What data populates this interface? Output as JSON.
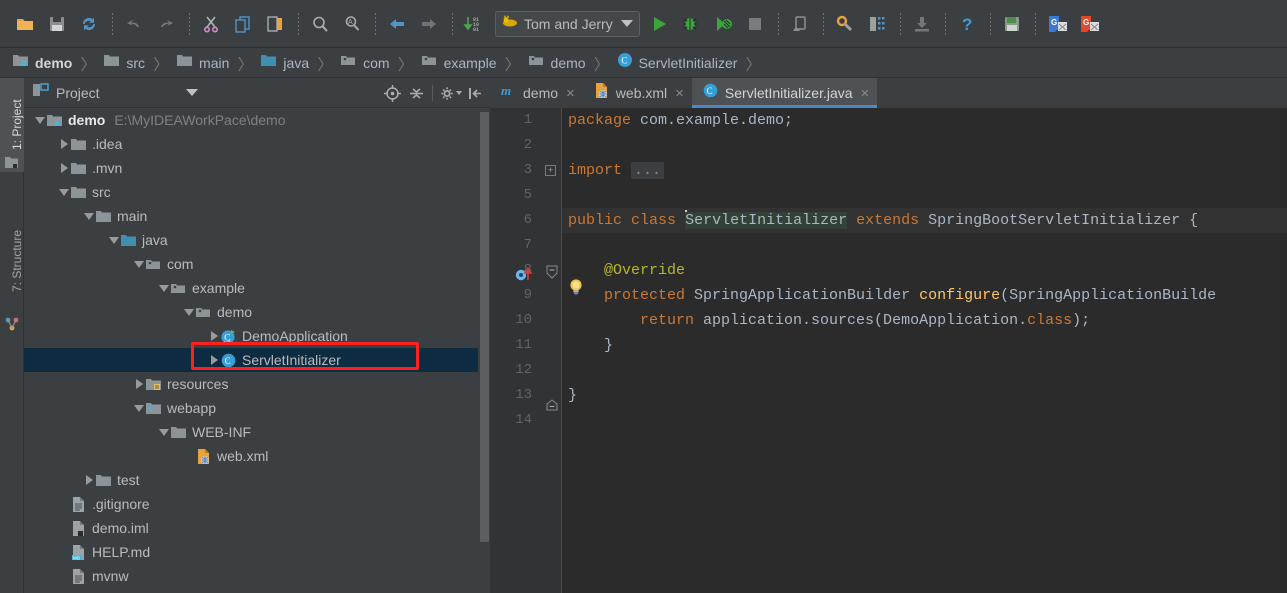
{
  "toolbar": {
    "icons": [
      {
        "name": "open-folder-icon",
        "label": "Open"
      },
      {
        "name": "save-all-icon",
        "label": "Save All"
      },
      {
        "name": "sync-refresh-icon",
        "label": "Synchronize"
      },
      {
        "name": "undo-icon",
        "label": "Undo"
      },
      {
        "name": "redo-icon",
        "label": "Redo"
      },
      {
        "name": "cut-icon",
        "label": "Cut"
      },
      {
        "name": "copy-icon",
        "label": "Copy"
      },
      {
        "name": "paste-icon",
        "label": "Paste"
      },
      {
        "name": "find-icon",
        "label": "Find"
      },
      {
        "name": "replace-icon",
        "label": "Replace"
      },
      {
        "name": "back-icon",
        "label": "Back"
      },
      {
        "name": "forward-icon",
        "label": "Forward"
      },
      {
        "name": "compile-icon",
        "label": "Compile"
      }
    ],
    "run_config": {
      "name": "Tom and Jerry",
      "icon": "tomcat-icon"
    },
    "run_icons": [
      {
        "name": "run-icon",
        "label": "Run"
      },
      {
        "name": "debug-icon",
        "label": "Debug"
      },
      {
        "name": "run-coverage-icon",
        "label": "Run with Coverage"
      },
      {
        "name": "stop-icon",
        "label": "Stop"
      }
    ],
    "right_icons": [
      {
        "name": "update-app-icon",
        "label": "Update application"
      },
      {
        "name": "settings-wrench-icon",
        "label": "Settings"
      },
      {
        "name": "project-structure-icon",
        "label": "Project Structure"
      },
      {
        "name": "download-icon",
        "label": "Update Project"
      },
      {
        "name": "help-icon",
        "label": "Help"
      },
      {
        "name": "save-floppy-icon",
        "label": "Save"
      },
      {
        "name": "translate-blue-icon",
        "label": "Translate"
      },
      {
        "name": "translate-red-icon",
        "label": "Translate Replace"
      }
    ]
  },
  "breadcrumb": {
    "items": [
      {
        "label": "demo",
        "icon": "module-folder-icon"
      },
      {
        "label": "src",
        "icon": "folder-icon"
      },
      {
        "label": "main",
        "icon": "folder-icon"
      },
      {
        "label": "java",
        "icon": "source-folder-icon"
      },
      {
        "label": "com",
        "icon": "package-icon"
      },
      {
        "label": "example",
        "icon": "package-icon"
      },
      {
        "label": "demo",
        "icon": "package-icon"
      },
      {
        "label": "ServletInitializer",
        "icon": "class-icon"
      }
    ],
    "separator": "〉"
  },
  "tool_window_tabs": [
    {
      "label": "1: Project",
      "icon": "project-icon",
      "active": true
    },
    {
      "label": "7: Structure",
      "icon": "structure-icon",
      "active": false
    }
  ],
  "project_panel": {
    "title": "Project",
    "title_icon": "project-view-icon",
    "dropdown_icon": "chevron-down-icon",
    "tools": [
      {
        "name": "locate-target-icon",
        "label": "Select Opened File"
      },
      {
        "name": "collapse-all-icon",
        "label": "Collapse All"
      },
      {
        "name": "gear-settings-icon",
        "label": "Settings"
      },
      {
        "name": "hide-panel-icon",
        "label": "Hide"
      }
    ],
    "tree": [
      {
        "depth": 0,
        "arrow": "expanded",
        "icon": "module-icon",
        "label": "demo",
        "bold": true,
        "path": "E:\\MyIDEAWorkPace\\demo",
        "selected": false
      },
      {
        "depth": 1,
        "arrow": "collapsed",
        "icon": "folder-icon",
        "label": ".idea",
        "bold": false,
        "path": "",
        "selected": false
      },
      {
        "depth": 1,
        "arrow": "collapsed",
        "icon": "folder-icon",
        "label": ".mvn",
        "bold": false,
        "path": "",
        "selected": false
      },
      {
        "depth": 1,
        "arrow": "expanded",
        "icon": "folder-icon",
        "label": "src",
        "bold": false,
        "path": "",
        "selected": false
      },
      {
        "depth": 2,
        "arrow": "expanded",
        "icon": "folder-icon",
        "label": "main",
        "bold": false,
        "path": "",
        "selected": false
      },
      {
        "depth": 3,
        "arrow": "expanded",
        "icon": "source-folder-icon",
        "label": "java",
        "bold": false,
        "path": "",
        "selected": false
      },
      {
        "depth": 4,
        "arrow": "expanded",
        "icon": "package-icon",
        "label": "com",
        "bold": false,
        "path": "",
        "selected": false
      },
      {
        "depth": 5,
        "arrow": "expanded",
        "icon": "package-icon",
        "label": "example",
        "bold": false,
        "path": "",
        "selected": false
      },
      {
        "depth": 6,
        "arrow": "expanded",
        "icon": "package-icon",
        "label": "demo",
        "bold": false,
        "path": "",
        "selected": false
      },
      {
        "depth": 7,
        "arrow": "collapsed",
        "icon": "spring-class-icon",
        "label": "DemoApplication",
        "bold": false,
        "path": "",
        "selected": false
      },
      {
        "depth": 7,
        "arrow": "collapsed",
        "icon": "class-icon",
        "label": "ServletInitializer",
        "bold": false,
        "path": "",
        "selected": true
      },
      {
        "depth": 3,
        "arrow": "collapsed",
        "icon": "resource-folder-icon",
        "label": "resources",
        "bold": false,
        "path": "",
        "selected": false
      },
      {
        "depth": 3,
        "arrow": "expanded",
        "icon": "webapp-folder-icon",
        "label": "webapp",
        "bold": false,
        "path": "",
        "selected": false
      },
      {
        "depth": 4,
        "arrow": "expanded",
        "icon": "folder-icon",
        "label": "WEB-INF",
        "bold": false,
        "path": "",
        "selected": false
      },
      {
        "depth": 5,
        "arrow": "none",
        "icon": "xml-file-icon",
        "label": "web.xml",
        "bold": false,
        "path": "",
        "selected": false
      },
      {
        "depth": 2,
        "arrow": "collapsed",
        "icon": "folder-icon",
        "label": "test",
        "bold": false,
        "path": "",
        "selected": false
      },
      {
        "depth": 1,
        "arrow": "none",
        "icon": "text-file-icon",
        "label": ".gitignore",
        "bold": false,
        "path": "",
        "selected": false
      },
      {
        "depth": 1,
        "arrow": "none",
        "icon": "iml-file-icon",
        "label": "demo.iml",
        "bold": false,
        "path": "",
        "selected": false
      },
      {
        "depth": 1,
        "arrow": "none",
        "icon": "markdown-file-icon",
        "label": "HELP.md",
        "bold": false,
        "path": "",
        "selected": false
      },
      {
        "depth": 1,
        "arrow": "none",
        "icon": "text-file-icon",
        "label": "mvnw",
        "bold": false,
        "path": "",
        "selected": false
      }
    ]
  },
  "editor": {
    "tabs": [
      {
        "label": "demo",
        "icon": "maven-icon",
        "active": false,
        "close": "×"
      },
      {
        "label": "web.xml",
        "icon": "xml-file-icon",
        "active": false,
        "close": "×"
      },
      {
        "label": "ServletInitializer.java",
        "icon": "class-icon",
        "active": true,
        "close": "×"
      }
    ],
    "line_numbers": [
      "1",
      "2",
      "3",
      "5",
      "6",
      "7",
      "8",
      "9",
      "10",
      "11",
      "12",
      "13",
      "14"
    ],
    "fold_placeholder": "...",
    "code": {
      "l1_kw": "package",
      "l1_rest": " com.example.demo;",
      "l3_kw": "import",
      "l6_kw1": "public",
      "l6_kw2": "class",
      "l6_name": "ServletInitializer",
      "l6_kw3": "extends",
      "l6_super": "SpringBootServletInitializer {",
      "l8_anno": "@Override",
      "l9_kw": "protected",
      "l9_type": " SpringApplicationBuilder ",
      "l9_fn": "configure",
      "l9_rest": "(SpringApplicationBuilde",
      "l10_kw": "return",
      "l10_a": " application.sources(DemoApplication.",
      "l10_kw2": "class",
      "l10_b": ");",
      "l11_brace": "}",
      "l13_brace": "}"
    },
    "gutter_icons": [
      {
        "name": "fold-expand-icon",
        "line": "3",
        "glyph": "+"
      },
      {
        "name": "override-method-icon",
        "line": "9"
      },
      {
        "name": "fold-collapse-icon",
        "line": "9"
      },
      {
        "name": "fold-end-icon",
        "line": "11"
      }
    ],
    "intention_bulb": {
      "name": "intention-bulb-icon"
    }
  },
  "colors": {
    "bg_chrome": "#3c3f41",
    "bg_editor": "#2b2b2b",
    "bg_gutter": "#313335",
    "selection_navy": "#0d2b41",
    "annotation_red": "#ff2020",
    "accent_blue": "#4a88c7",
    "keyword_orange": "#cc7832",
    "text_default": "#a9b7c6",
    "annotation_yellow": "#bbb529",
    "method_yellow": "#ffc66d"
  }
}
